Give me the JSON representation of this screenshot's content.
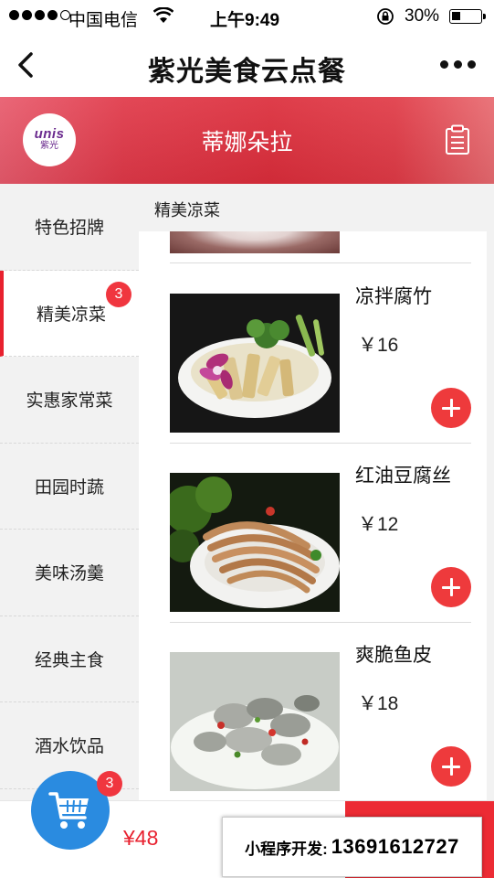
{
  "status_bar": {
    "carrier": "中国电信",
    "time": "上午9:49",
    "battery": "30%"
  },
  "nav": {
    "title": "紫光美食云点餐"
  },
  "header": {
    "logo_text": "unis",
    "logo_sub": "紫光",
    "shop_name": "蒂娜朵拉"
  },
  "sidebar": {
    "categories": [
      {
        "label": "特色招牌"
      },
      {
        "label": "精美凉菜",
        "badge": "3",
        "active": true
      },
      {
        "label": "实惠家常菜"
      },
      {
        "label": "田园时蔬"
      },
      {
        "label": "美味汤羹"
      },
      {
        "label": "经典主食"
      },
      {
        "label": "酒水饮品"
      }
    ]
  },
  "content": {
    "section_title": "精美凉菜",
    "items": [
      {
        "name": "凉拌腐竹",
        "price": "￥16"
      },
      {
        "name": "红油豆腐丝",
        "price": "￥12"
      },
      {
        "name": "爽脆鱼皮",
        "price": "￥18"
      }
    ]
  },
  "bottom": {
    "cart_count": "3",
    "total": "¥48",
    "dev_label": "小程序开发:",
    "dev_phone": "13691612727"
  },
  "colors": {
    "accent": "#e8212f",
    "header": "#dc2d3b",
    "cart": "#2a8be0",
    "add_button": "#ee3a3c"
  }
}
